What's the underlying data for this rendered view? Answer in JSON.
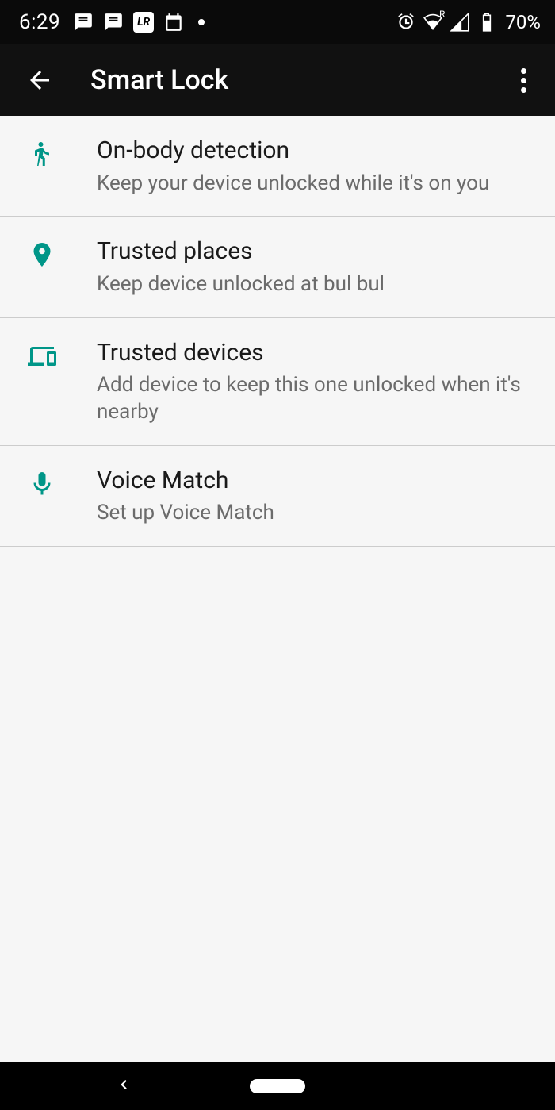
{
  "status": {
    "time": "6:29",
    "battery_pct": "70%",
    "lr_label": "LR",
    "roaming": "R"
  },
  "header": {
    "title": "Smart Lock"
  },
  "items": [
    {
      "title": "On-body detection",
      "subtitle": "Keep your device unlocked while it's on you"
    },
    {
      "title": "Trusted places",
      "subtitle": "Keep device unlocked at bul bul"
    },
    {
      "title": "Trusted devices",
      "subtitle": "Add device to keep this one unlocked when it's nearby"
    },
    {
      "title": "Voice Match",
      "subtitle": "Set up Voice Match"
    }
  ]
}
